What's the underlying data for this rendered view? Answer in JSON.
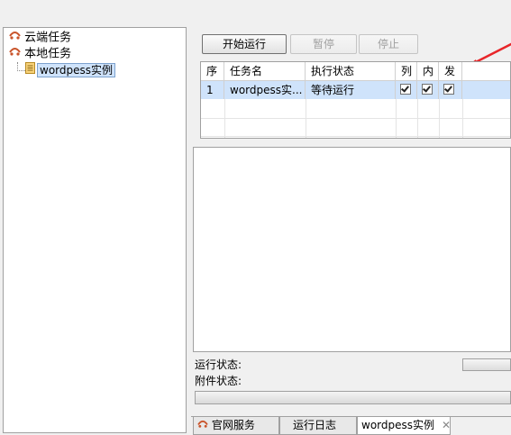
{
  "tree": {
    "cloud_tasks": "云端任务",
    "local_tasks": "本地任务",
    "wordpress_task": "wordpess实例"
  },
  "toolbar": {
    "start_label": "开始运行",
    "pause_label": "暂停",
    "stop_label": "停止"
  },
  "task_table": {
    "headers": [
      "序",
      "任务名",
      "执行状态",
      "列",
      "内",
      "发"
    ],
    "rows": [
      {
        "index": "1",
        "name": "wordpess实...",
        "status": "等待运行",
        "col": true,
        "inner": true,
        "post": true
      }
    ]
  },
  "status": {
    "run_status_label": "运行状态:",
    "attach_status_label": "附件状态:",
    "progress": 0
  },
  "tabs": {
    "official_label": "官网服务",
    "log_label": "运行日志",
    "wordpress_label": "wordpess实例",
    "close_glyph": "✕"
  },
  "colors": {
    "selection": "#cfe3fb",
    "annotation_arrow": "#e8262a"
  },
  "icons": [
    "task-tree-icon",
    "document-icon",
    "close-icon",
    "annotation-arrow-icon"
  ]
}
